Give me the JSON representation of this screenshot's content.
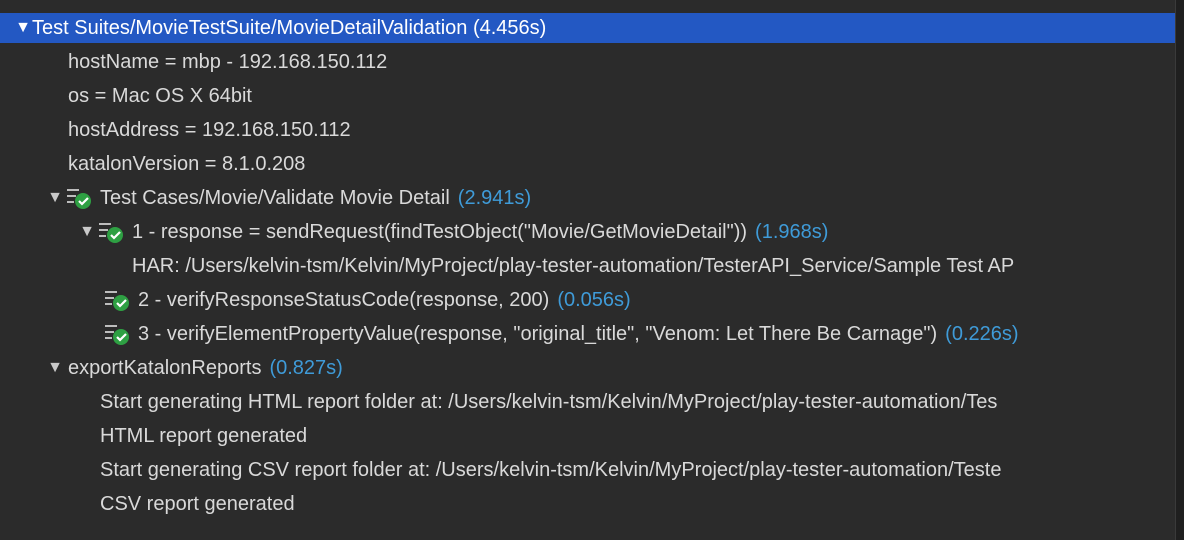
{
  "suite": {
    "label": "Test Suites/MovieTestSuite/MovieDetailValidation (4.456s)",
    "properties": [
      "hostName = mbp - 192.168.150.112",
      "os = Mac OS X 64bit",
      "hostAddress = 192.168.150.112",
      "katalonVersion = 8.1.0.208"
    ]
  },
  "test_case": {
    "label": "Test Cases/Movie/Validate Movie Detail",
    "duration": "(2.941s)"
  },
  "steps": [
    {
      "label": "1 - response = sendRequest(findTestObject(\"Movie/GetMovieDetail\"))",
      "duration": "(1.968s)"
    },
    {
      "label": "2 - verifyResponseStatusCode(response, 200)",
      "duration": "(0.056s)"
    },
    {
      "label": "3 - verifyElementPropertyValue(response, \"original_title\", \"Venom: Let There Be Carnage\")",
      "duration": "(0.226s)"
    }
  ],
  "har_line": "HAR: /Users/kelvin-tsm/Kelvin/MyProject/play-tester-automation/TesterAPI_Service/Sample Test AP",
  "export": {
    "label": "exportKatalonReports",
    "duration": "(0.827s)",
    "lines": [
      "Start generating HTML report folder at: /Users/kelvin-tsm/Kelvin/MyProject/play-tester-automation/Tes",
      "HTML report generated",
      "Start generating CSV report folder at: /Users/kelvin-tsm/Kelvin/MyProject/play-tester-automation/Teste",
      "CSV report generated"
    ]
  },
  "colors": {
    "selection": "#2358c3",
    "duration": "#3f9bd8",
    "passed": "#2ea043",
    "background": "#2b2b2b"
  },
  "icons": {
    "passed": "passed-check-icon",
    "expand": "triangle-down-icon"
  }
}
